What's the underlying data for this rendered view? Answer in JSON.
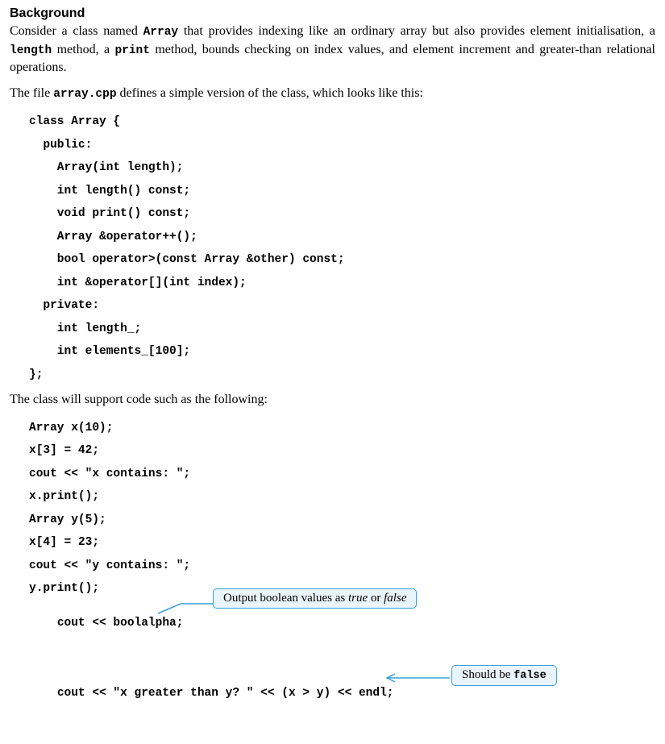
{
  "heading": "Background",
  "para1_pre": "Consider a class named ",
  "para1_class": "Array",
  "para1_mid1": " that provides indexing like an ordinary array but also provides element initialisation, a ",
  "para1_length": "length",
  "para1_mid2": " method, a ",
  "para1_print": "print",
  "para1_mid3": " method, bounds checking on index values, and element increment and greater-than relational operations.",
  "para2_pre": "The file ",
  "para2_file": "array.cpp",
  "para2_post": " defines a simple version of the class, which looks like this:",
  "class_def": {
    "l0": "class Array {",
    "l1": "  public:",
    "l2": "    Array(int length);",
    "l3": "    int length() const;",
    "l4": "    void print() const;",
    "l5": "    Array &operator++();",
    "l6": "    bool operator>(const Array &other) const;",
    "l7": "    int &operator[](int index);",
    "l8": "  private:",
    "l9": "    int length_;",
    "l10": "    int elements_[100];",
    "l11": "};"
  },
  "para3": "The class will support code such as the following:",
  "example": {
    "e0": "Array x(10);",
    "e1": "x[3] = 42;",
    "e2": "cout << \"x contains: \";",
    "e3": "x.print();",
    "e4": "Array y(5);",
    "e5": "x[4] = 23;",
    "e6": "cout << \"y contains: \";",
    "e7": "y.print();",
    "e8": "cout << boolalpha;",
    "e9": "cout << \"x greater than y? \" << (x > y) << endl;"
  },
  "callout1_pre": "Output boolean values as ",
  "callout1_true": "true",
  "callout1_or": " or ",
  "callout1_false": "false",
  "callout2_pre": "Should be ",
  "callout2_val": "false"
}
